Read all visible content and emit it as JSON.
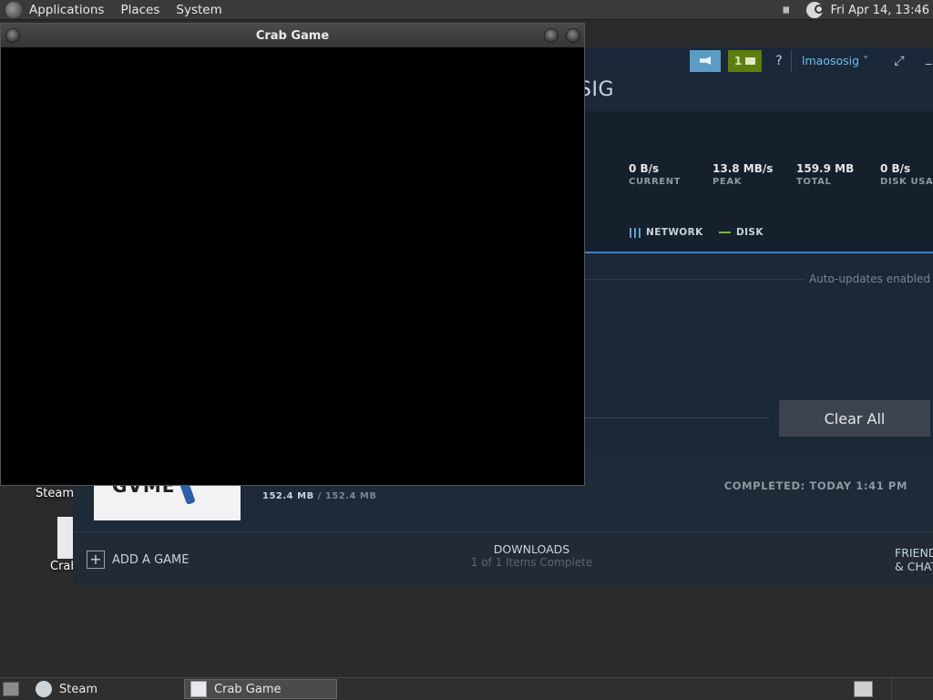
{
  "top_panel": {
    "menus": [
      "Applications",
      "Places",
      "System"
    ],
    "clock": "Fri Apr 14, 13:46",
    "icons": [
      "distro-logo-icon",
      "volume-icon",
      "steam-tray-icon"
    ]
  },
  "desktop": {
    "icon_labels": [
      "Steam",
      "Crab"
    ]
  },
  "steam": {
    "notifications_count": "1",
    "help": "?",
    "account_name": "lmaososig ˅",
    "user_title": "SIG",
    "stats": [
      {
        "value": "0 B/s",
        "label": "CURRENT"
      },
      {
        "value": "13.8 MB/s",
        "label": "PEAK"
      },
      {
        "value": "159.9 MB",
        "label": "TOTAL"
      },
      {
        "value": "0 B/s",
        "label": "DISK USAG"
      }
    ],
    "legend": {
      "network": "NETWORK",
      "disk": "DISK"
    },
    "auto_updates": "Auto-updates enabled",
    "clear_all": "Clear All",
    "download": {
      "thumb_text": "GVME",
      "size_done": "152.4 MB",
      "size_sep": "/",
      "size_total": "152.4 MB",
      "completed": "COMPLETED: TODAY 1:41 PM"
    },
    "bottom": {
      "add_game": "ADD A GAME",
      "downloads_title": "DOWNLOADS",
      "downloads_status": "1 of 1 Items Complete",
      "friends_line1": "FRIEND",
      "friends_line2": "& CHAT"
    }
  },
  "crab_window": {
    "title": "Crab Game"
  },
  "taskbar": {
    "tasks": [
      {
        "label": "Steam"
      },
      {
        "label": "Crab Game"
      }
    ]
  },
  "colors": {
    "steam_bg": "#1b2838",
    "accent_blue": "#3d7ec9",
    "notif_green": "#5c7e10",
    "announce_blue": "#5a9cc2"
  }
}
